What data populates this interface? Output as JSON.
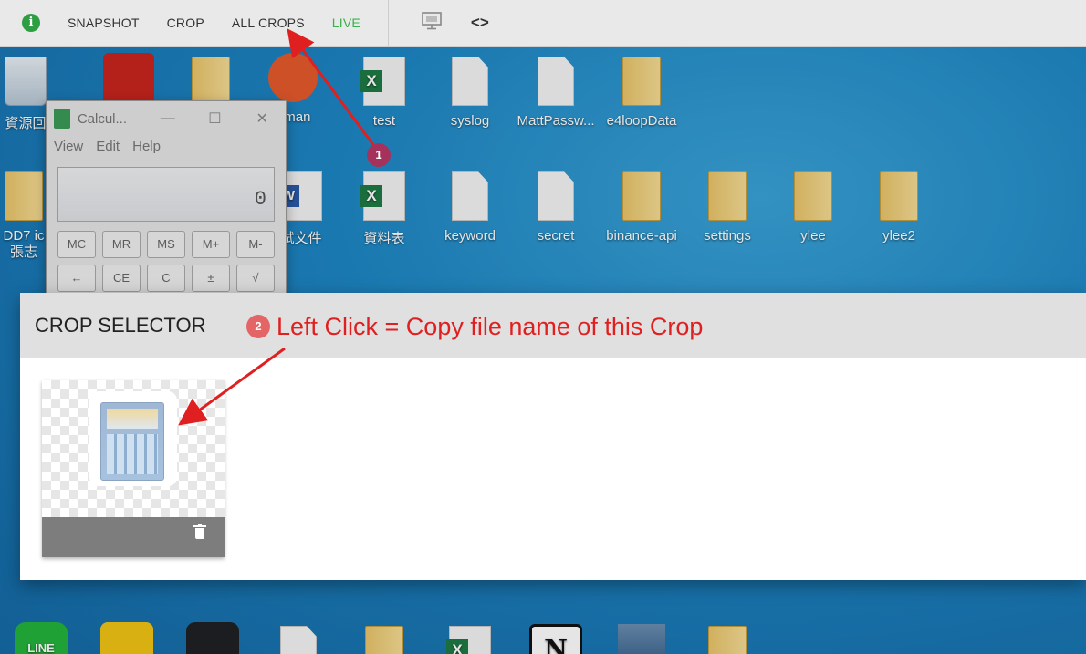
{
  "toolbar": {
    "info_icon": "i",
    "tabs": [
      "SNAPSHOT",
      "CROP",
      "ALL CROPS",
      "LIVE"
    ],
    "live_color": "#38b24a",
    "screen_icon": "monitor-icon",
    "code_icon": "<>"
  },
  "desktop": {
    "row1": [
      "資源回",
      "",
      "",
      "stman",
      "test",
      "syslog",
      "MattPassw...",
      "e4loopData"
    ],
    "row2": [
      "DD7 ic",
      "張志",
      "試文件",
      "資料表",
      "keyword",
      "secret",
      "binance-api",
      "settings",
      "ylee",
      "ylee2"
    ],
    "bottom_line_label": "LINE"
  },
  "calculator": {
    "title": "Calcul...",
    "menu": [
      "View",
      "Edit",
      "Help"
    ],
    "display": "0",
    "keys": [
      "MC",
      "MR",
      "MS",
      "M+",
      "M-",
      "←",
      "CE",
      "C",
      "±",
      "√"
    ],
    "window_buttons": [
      "—",
      "☐",
      "✕"
    ]
  },
  "crop_selector": {
    "title": "CROP SELECTOR",
    "card_icon": "calculator-thumbnail",
    "delete_icon": "trash-icon"
  },
  "annotations": {
    "badge1": "1",
    "badge2": "2",
    "note2": "Left Click = Copy file name of this Crop",
    "color": "#e02020"
  }
}
